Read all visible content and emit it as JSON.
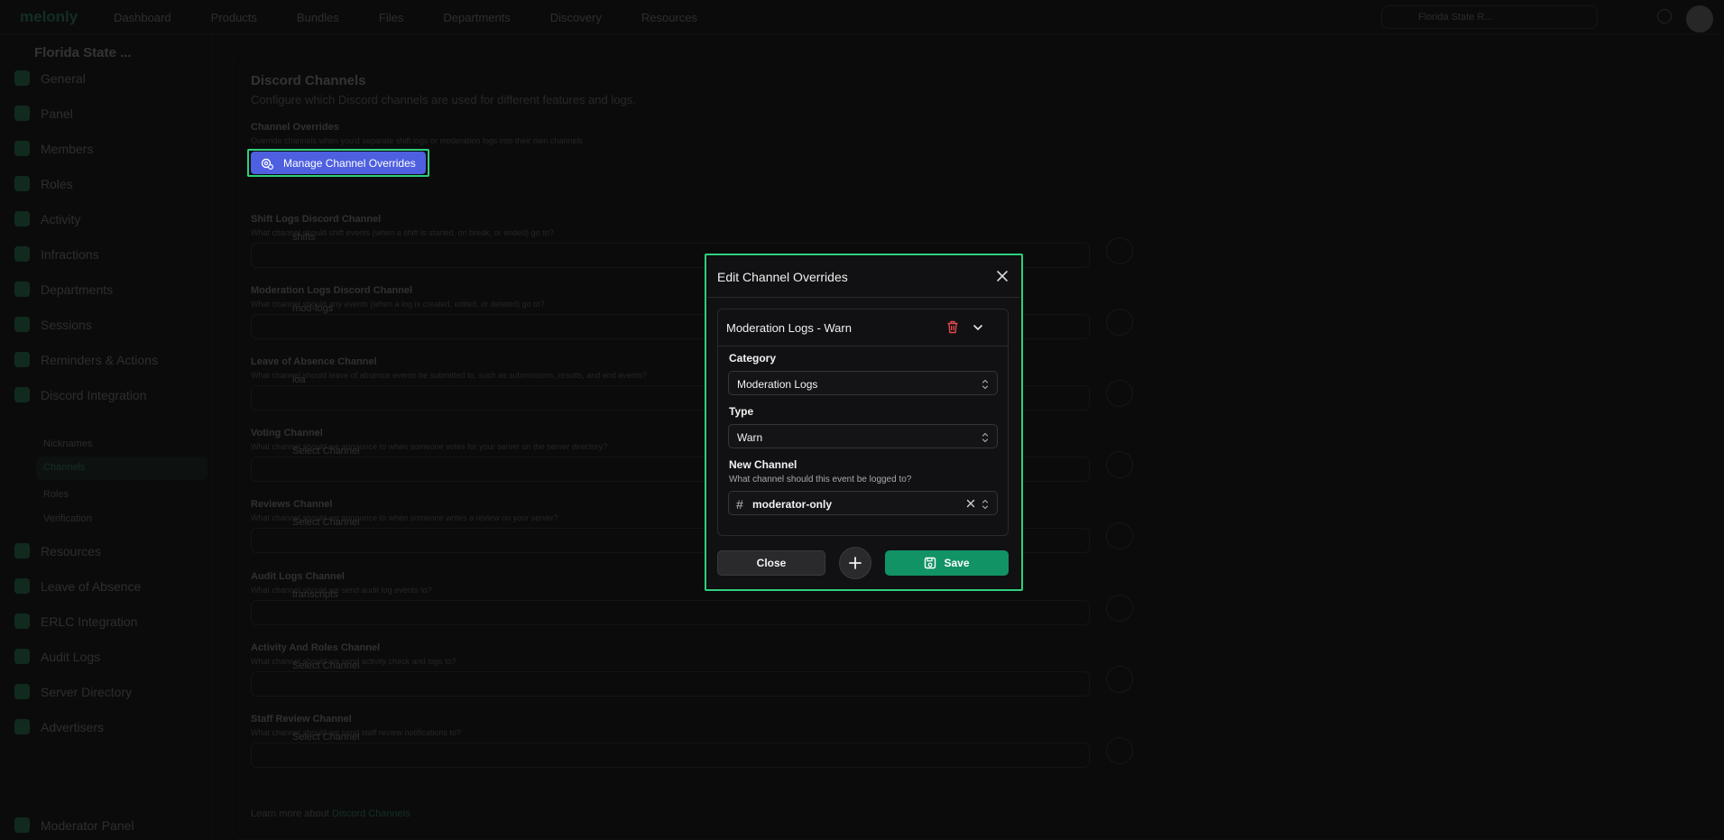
{
  "topnav": {
    "logo": "melonly",
    "items": [
      "Dashboard",
      "Products",
      "Bundles",
      "Files",
      "Departments",
      "Discovery",
      "Resources"
    ],
    "server_short": "Florida State R..."
  },
  "sidebar": {
    "server_name": "Florida State ...",
    "items": [
      {
        "label": "General"
      },
      {
        "label": "Panel"
      },
      {
        "label": "Members"
      },
      {
        "label": "Roles"
      },
      {
        "label": "Activity"
      },
      {
        "label": "Infractions"
      },
      {
        "label": "Departments"
      },
      {
        "label": "Sessions"
      },
      {
        "label": "Reminders & Actions"
      },
      {
        "label": "Discord Integration"
      }
    ],
    "subitems": [
      "Nicknames",
      "Channels",
      "Roles",
      "Verification"
    ],
    "items2": [
      {
        "label": "Resources"
      },
      {
        "label": "Leave of Absence"
      },
      {
        "label": "ERLC Integration"
      },
      {
        "label": "Audit Logs"
      },
      {
        "label": "Server Directory"
      },
      {
        "label": "Advertisers"
      }
    ],
    "footer": "Moderator Panel"
  },
  "main": {
    "title": "Discord Channels",
    "subtitle": "Configure which Discord channels are used for different features and logs.",
    "overrides_label": "Channel Overrides",
    "overrides_help": "Override channels when you'd separate shift logs or moderation logs into their own channels",
    "manage_button": "Manage Channel Overrides",
    "fields": [
      {
        "label": "Shift Logs Discord Channel",
        "help": "What channel should shift events (when a shift is started, on break, or ended) go to?",
        "value": "shifts"
      },
      {
        "label": "Moderation Logs Discord Channel",
        "help": "What channel should any events (when a log is created, edited, or deleted) go to?",
        "value": "mod-logs"
      },
      {
        "label": "Leave of Absence Channel",
        "help": "What channel should leave of absence events be submitted to, such as submissions, results, and end events?",
        "value": "loa"
      },
      {
        "label": "Voting Channel",
        "help": "What channel should we announce to when someone votes for your server on the server directory?",
        "value": "Select Channel"
      },
      {
        "label": "Reviews Channel",
        "help": "What channel should we announce to when someone writes a review on your server?",
        "value": "Select Channel"
      },
      {
        "label": "Audit Logs Channel",
        "help": "What channel should we send audit log events to?",
        "value": "transcripts"
      },
      {
        "label": "Activity And Roles Channel",
        "help": "What channel should we send activity check and logs to?",
        "value": "Select Channel"
      },
      {
        "label": "Staff Review Channel",
        "help": "What channel should we send staff review notifications to?",
        "value": "Select Channel"
      }
    ],
    "learn_more": "Learn more about",
    "learn_more_link": "Discord Channels"
  },
  "modal": {
    "title": "Edit Channel Overrides",
    "card_title": "Moderation Logs - Warn",
    "category_label": "Category",
    "category_value": "Moderation Logs",
    "type_label": "Type",
    "type_value": "Warn",
    "channel_label": "New Channel",
    "channel_help": "What channel should this event be logged to?",
    "channel_value": "moderator-only",
    "close_label": "Close",
    "save_label": "Save"
  }
}
